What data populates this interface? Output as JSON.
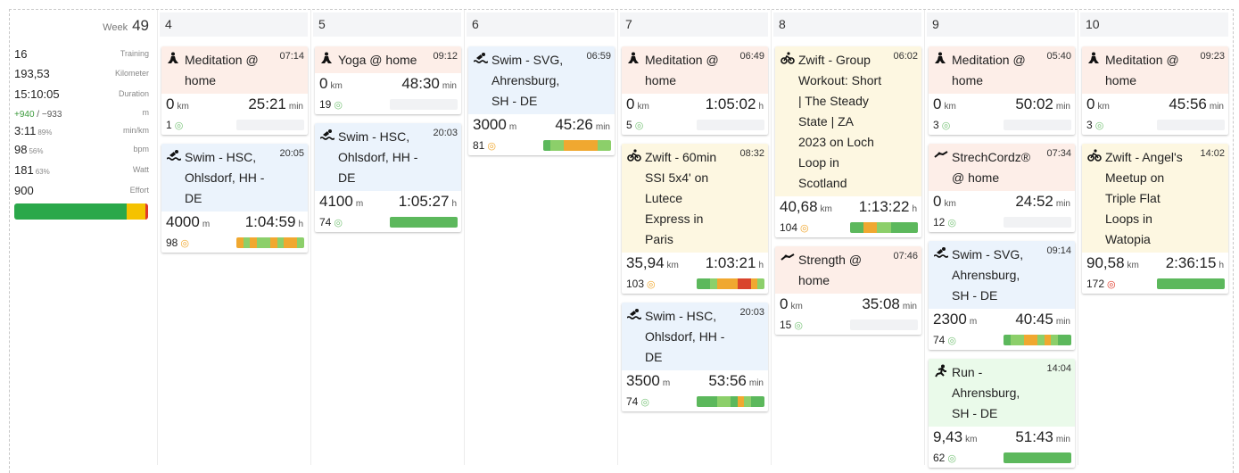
{
  "summary": {
    "week_label": "Week",
    "week_number": "49",
    "rows": [
      {
        "value": "16",
        "sub": "",
        "label": "Training"
      },
      {
        "value": "193,53",
        "sub": "",
        "label": "Kilometer"
      },
      {
        "value": "15:10:05",
        "sub": "",
        "label": "Duration"
      },
      {
        "value": "",
        "sub": "",
        "label": "m",
        "up": "+940",
        "down": "−933"
      },
      {
        "value": "3:11",
        "sub": "89%",
        "label": "min/km"
      },
      {
        "value": "98",
        "sub": "56%",
        "label": "bpm"
      },
      {
        "value": "181",
        "sub": "63%",
        "label": "Watt"
      },
      {
        "value": "900",
        "sub": "",
        "label": "Effort"
      }
    ],
    "effort_segments": [
      {
        "pct": 84,
        "color": "#2aa84a"
      },
      {
        "pct": 14,
        "color": "#f5c200"
      },
      {
        "pct": 2,
        "color": "#e03a2a"
      }
    ]
  },
  "days": [
    {
      "label": "4",
      "cards": [
        {
          "icon": "meditation-icon",
          "title": "Meditation @ home",
          "time": "07:14",
          "dist": "0",
          "dist_unit": "km",
          "dur": "25:21",
          "dur_unit": "min",
          "score": "1",
          "score_color": "#7ac47a",
          "bg": "red",
          "zones": []
        },
        {
          "icon": "swim-icon",
          "title": "Swim - HSC, Ohlsdorf, HH - DE",
          "time": "20:05",
          "dist": "4000",
          "dist_unit": "m",
          "dur": "1:04:59",
          "dur_unit": "h",
          "score": "98",
          "score_color": "#f0a830",
          "bg": "blue",
          "zones": [
            3,
            2,
            3,
            2,
            2,
            3,
            2,
            3,
            3,
            2
          ]
        }
      ]
    },
    {
      "label": "5",
      "cards": [
        {
          "icon": "yoga-icon",
          "title": "Yoga @ home",
          "time": "09:12",
          "dist": "0",
          "dist_unit": "km",
          "dur": "48:30",
          "dur_unit": "min",
          "score": "19",
          "score_color": "#7ac47a",
          "bg": "red",
          "zones": []
        },
        {
          "icon": "swim-icon",
          "title": "Swim - HSC, Ohlsdorf, HH - DE",
          "time": "20:03",
          "dist": "4100",
          "dist_unit": "m",
          "dur": "1:05:27",
          "dur_unit": "h",
          "score": "74",
          "score_color": "#7ac47a",
          "bg": "blue",
          "zones": [
            1,
            1,
            1,
            1,
            1,
            1,
            1,
            1,
            1,
            1
          ]
        }
      ]
    },
    {
      "label": "6",
      "cards": [
        {
          "icon": "swim-icon",
          "title": "Swim - SVG, Ahrensburg, SH - DE",
          "time": "06:59",
          "dist": "3000",
          "dist_unit": "m",
          "dur": "45:26",
          "dur_unit": "min",
          "score": "81",
          "score_color": "#f0a830",
          "bg": "blue",
          "zones": [
            1,
            2,
            2,
            3,
            3,
            3,
            3,
            3,
            2,
            2
          ]
        }
      ]
    },
    {
      "label": "7",
      "cards": [
        {
          "icon": "meditation-icon",
          "title": "Meditation @ home",
          "time": "06:49",
          "dist": "0",
          "dist_unit": "km",
          "dur": "1:05:02",
          "dur_unit": "h",
          "score": "5",
          "score_color": "#7ac47a",
          "bg": "red",
          "zones": []
        },
        {
          "icon": "bike-icon",
          "title": "Zwift - 60min SSI 5x4' on Lutece Express in Paris",
          "time": "08:32",
          "dist": "35,94",
          "dist_unit": "km",
          "dur": "1:03:21",
          "dur_unit": "h",
          "score": "103",
          "score_color": "#f0a830",
          "bg": "yellow",
          "zones": [
            1,
            1,
            2,
            3,
            3,
            3,
            4,
            4,
            3,
            2
          ]
        },
        {
          "icon": "swim-icon",
          "title": "Swim - HSC, Ohlsdorf, HH - DE",
          "time": "20:03",
          "dist": "3500",
          "dist_unit": "m",
          "dur": "53:56",
          "dur_unit": "min",
          "score": "74",
          "score_color": "#7ac47a",
          "bg": "blue",
          "zones": [
            1,
            1,
            1,
            2,
            2,
            1,
            3,
            2,
            1,
            1
          ]
        }
      ]
    },
    {
      "label": "8",
      "cards": [
        {
          "icon": "bike-icon",
          "title": "Zwift - Group Workout: Short | The Steady State | ZA 2023 on Loch Loop in Scotland",
          "time": "06:02",
          "dist": "40,68",
          "dist_unit": "km",
          "dur": "1:13:22",
          "dur_unit": "h",
          "score": "104",
          "score_color": "#f0a830",
          "bg": "yellow",
          "zones": [
            1,
            1,
            3,
            3,
            2,
            2,
            1,
            1,
            1,
            1
          ]
        },
        {
          "icon": "strength-icon",
          "title": "Strength @ home",
          "time": "07:46",
          "dist": "0",
          "dist_unit": "km",
          "dur": "35:08",
          "dur_unit": "min",
          "score": "15",
          "score_color": "#7ac47a",
          "bg": "red",
          "zones": []
        }
      ]
    },
    {
      "label": "9",
      "cards": [
        {
          "icon": "meditation-icon",
          "title": "Meditation @ home",
          "time": "05:40",
          "dist": "0",
          "dist_unit": "km",
          "dur": "50:02",
          "dur_unit": "min",
          "score": "3",
          "score_color": "#7ac47a",
          "bg": "red",
          "zones": []
        },
        {
          "icon": "strength-icon",
          "title": "StrechCordz® @ home",
          "time": "07:34",
          "dist": "0",
          "dist_unit": "km",
          "dur": "24:52",
          "dur_unit": "min",
          "score": "12",
          "score_color": "#7ac47a",
          "bg": "red",
          "zones": []
        },
        {
          "icon": "swim-icon",
          "title": "Swim - SVG, Ahrensburg, SH - DE",
          "time": "09:14",
          "dist": "2300",
          "dist_unit": "m",
          "dur": "40:45",
          "dur_unit": "min",
          "score": "74",
          "score_color": "#7ac47a",
          "bg": "blue",
          "zones": [
            1,
            2,
            2,
            3,
            3,
            2,
            3,
            2,
            1,
            1
          ]
        },
        {
          "icon": "run-icon",
          "title": "Run - Ahrensburg, SH - DE",
          "time": "14:04",
          "dist": "9,43",
          "dist_unit": "km",
          "dur": "51:43",
          "dur_unit": "min",
          "score": "62",
          "score_color": "#7ac47a",
          "bg": "green",
          "zones": [
            1,
            1,
            1,
            1,
            1,
            1,
            1,
            1,
            1,
            1
          ]
        }
      ]
    },
    {
      "label": "10",
      "cards": [
        {
          "icon": "meditation-icon",
          "title": "Meditation @ home",
          "time": "09:23",
          "dist": "0",
          "dist_unit": "km",
          "dur": "45:56",
          "dur_unit": "min",
          "score": "3",
          "score_color": "#7ac47a",
          "bg": "red",
          "zones": []
        },
        {
          "icon": "bike-icon",
          "title": "Zwift - Angel's Meetup on Triple Flat Loops in Watopia",
          "time": "14:02",
          "dist": "90,58",
          "dist_unit": "km",
          "dur": "2:36:15",
          "dur_unit": "h",
          "score": "172",
          "score_color": "#e03a2a",
          "bg": "yellow",
          "zones": [
            1,
            1,
            1,
            1,
            1,
            1,
            1,
            1,
            1,
            1
          ]
        }
      ]
    }
  ],
  "colors": {
    "zone1": "#5cb85c",
    "zone2": "#8ccf6a",
    "zone3": "#f0a830",
    "zone4": "#d9452c"
  }
}
